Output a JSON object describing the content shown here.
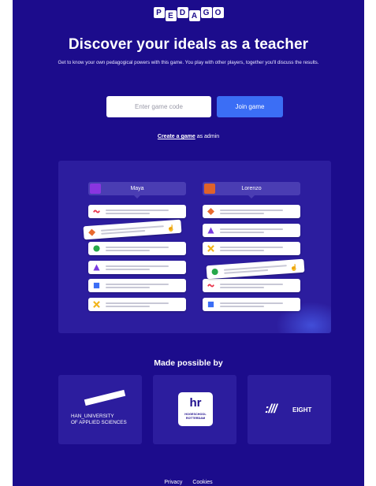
{
  "logo": {
    "letters": [
      "P",
      "E",
      "D",
      "A",
      "G",
      "O"
    ]
  },
  "hero": {
    "title": "Discover your ideals as a teacher",
    "subtitle": "Get to know your own pedagogical powers with this game. You play with other players, together you'll discuss the results."
  },
  "join": {
    "placeholder": "Enter game code",
    "button_label": "Join game"
  },
  "create": {
    "link_text": "Create a game",
    "suffix": " as admin"
  },
  "illustration": {
    "players": [
      {
        "name": "Maya",
        "avatar_color": "#8a35e0"
      },
      {
        "name": "Lorenzo",
        "avatar_color": "#e0622a"
      }
    ],
    "colors": {
      "red": "#e8334a",
      "orange": "#e86a2e",
      "green": "#27a84a",
      "purple": "#7a3be0",
      "blue": "#3b6ef5",
      "yellow": "#f2b51c"
    }
  },
  "partners": {
    "heading": "Made possible by",
    "han": {
      "line1": "HAN_UNIVERSITY",
      "line2": "OF APPLIED SCIENCES"
    },
    "hr": {
      "mark": "hr",
      "line1": "HOGESCHOOL",
      "line2": "ROTTERDAM"
    },
    "eight": {
      "mark": ":///",
      "name": "EIGHT"
    }
  },
  "footer": {
    "privacy": "Privacy",
    "cookies": "Cookies"
  },
  "theme": {
    "background": "#1c0c8c",
    "panel": "#2c1d9e",
    "accent": "#3b6ef5"
  }
}
